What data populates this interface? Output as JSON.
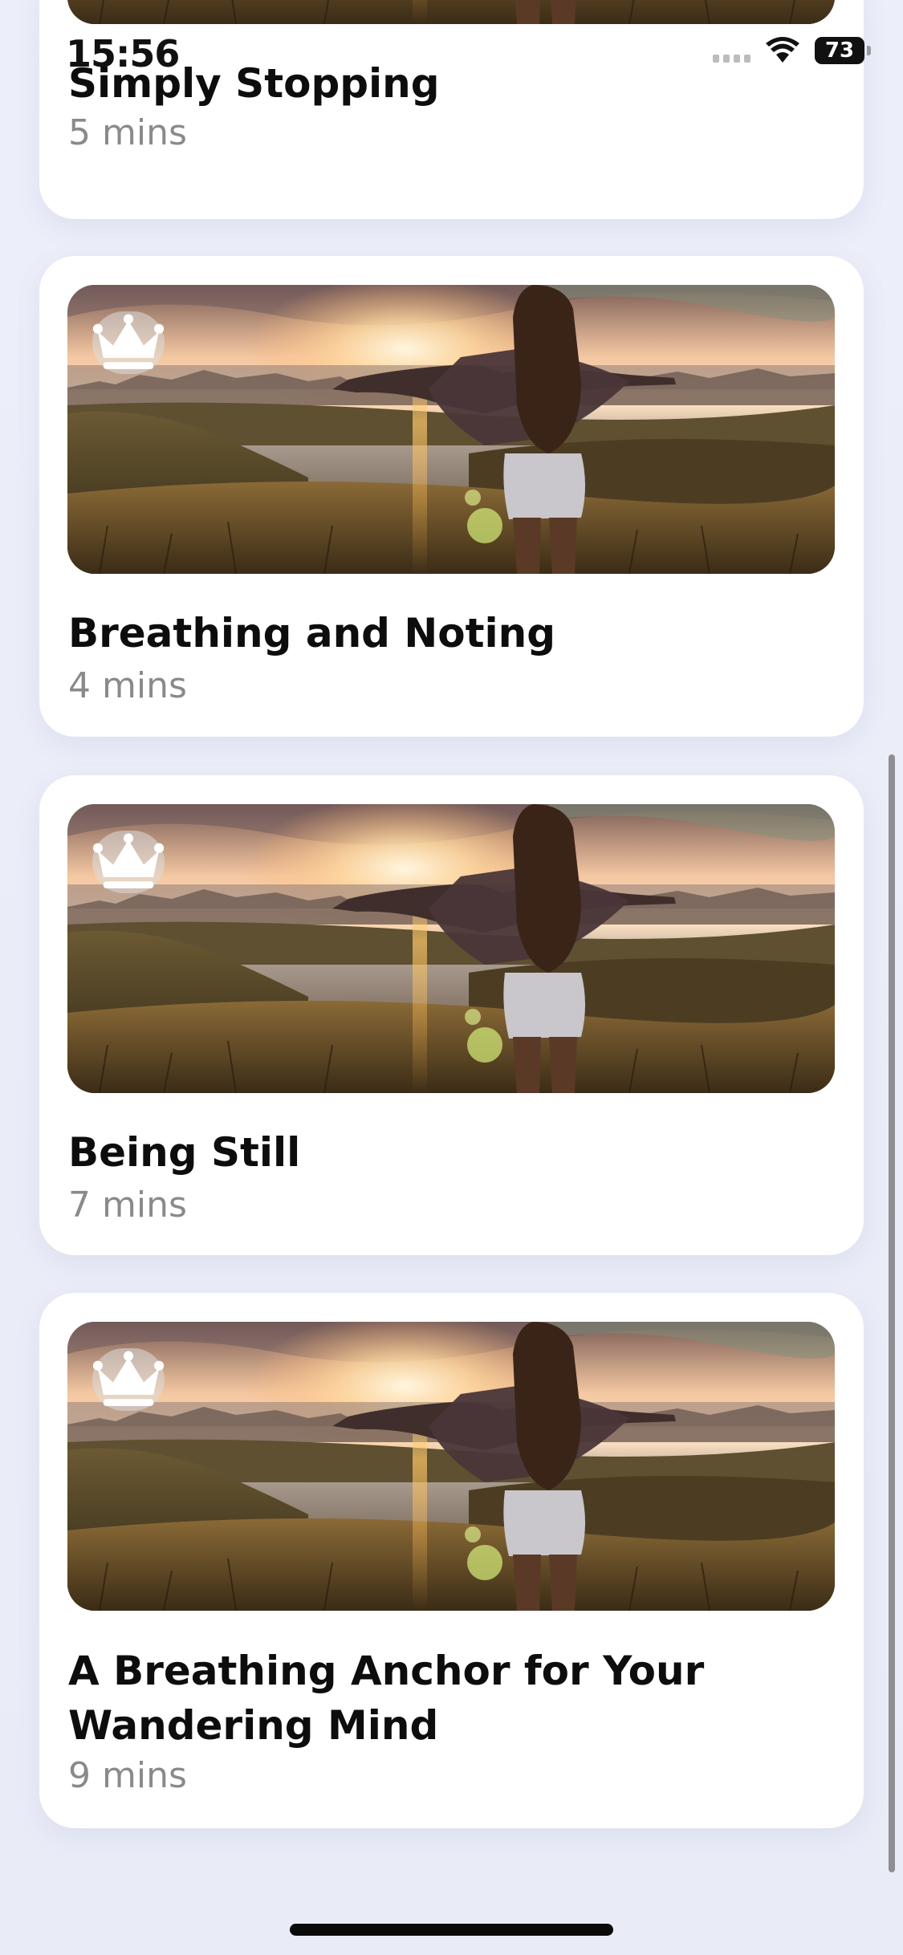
{
  "status_bar": {
    "time": "15:56",
    "battery": "73"
  },
  "sessions": [
    {
      "title": "Simply Stopping",
      "duration": "5 mins",
      "premium": true
    },
    {
      "title": "Breathing and Noting",
      "duration": "4 mins",
      "premium": true
    },
    {
      "title": "Being Still",
      "duration": "7 mins",
      "premium": true
    },
    {
      "title": "A Breathing Anchor for Your Wandering Mind",
      "duration": "9 mins",
      "premium": true
    }
  ],
  "icons": {
    "premium": "crown-icon",
    "wifi": "wifi-icon",
    "signal": "cellular-signal-icon",
    "battery": "battery-icon"
  },
  "colors": {
    "background": "#eceef9",
    "card": "#ffffff",
    "title_text": "#0d0d0d",
    "duration_text": "#8a8a8a"
  }
}
